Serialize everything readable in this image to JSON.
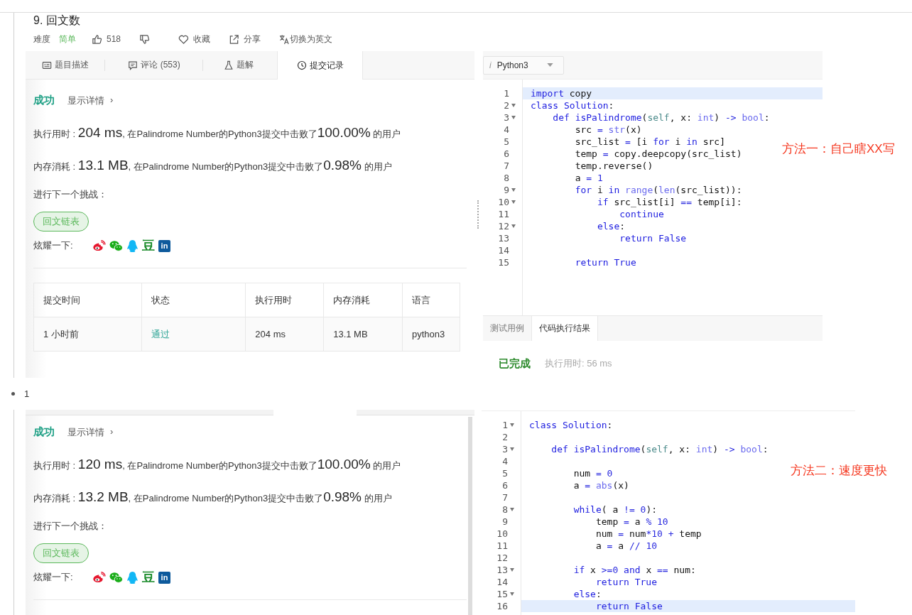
{
  "first_shot": {
    "problem": {
      "title": "9. 回文数",
      "difficulty_label": "难度",
      "difficulty": "简单",
      "likes": "518",
      "favorite": "收藏",
      "share": "分享",
      "switch_language": "切换为英文"
    },
    "tabs": [
      {
        "label": "题目描述",
        "selected": false
      },
      {
        "label": "评论 (553)",
        "selected": false
      },
      {
        "label": "题解",
        "selected": false
      },
      {
        "label": "提交记录",
        "selected": true
      }
    ],
    "result": {
      "status": "成功",
      "details": "显示详情",
      "chevron": "›",
      "stats": [
        {
          "label": "执行用时 : ",
          "value": "204 ms",
          "text": ", 在Palindrome Number的Python3提交中击败了",
          "percent": "100.00%",
          "suffix": " 的用户"
        },
        {
          "label": "内存消耗 : ",
          "value": "13.1 MB",
          "text": ", 在Palindrome Number的Python3提交中击败了",
          "percent": "0.98%",
          "suffix": " 的用户"
        }
      ],
      "next_label": "进行下一个挑战：",
      "next_tag": "回文链表",
      "share_label": "炫耀一下:",
      "share_icons": [
        {
          "kind": "swirl"
        },
        {
          "kind": "chat"
        },
        {
          "kind": "penguin"
        },
        {
          "kind": "glyph",
          "text": "豆"
        },
        {
          "kind": "badge",
          "text": "in"
        }
      ],
      "table": {
        "columns": [
          "提交时间",
          "状态",
          "执行用时",
          "内存消耗",
          "语言"
        ],
        "rows": [
          [
            {
              "text": "1 小时前",
              "kind": "plain"
            },
            {
              "text": "通过",
              "kind": "status"
            },
            {
              "text": "204 ms",
              "kind": "plain"
            },
            {
              "text": "13.1 MB",
              "kind": "plain"
            },
            {
              "text": "python3",
              "kind": "plain"
            }
          ]
        ]
      }
    },
    "editor": {
      "language_info": "i",
      "language": "Python3",
      "code": [
        {
          "number": "1",
          "text": "import copy",
          "fold": false,
          "highlighted": true
        },
        {
          "number": "2",
          "text": "class Solution:",
          "fold": true,
          "highlighted": false
        },
        {
          "number": "3",
          "text": "    def isPalindrome(self, x: int) -> bool:",
          "fold": true,
          "highlighted": false
        },
        {
          "number": "4",
          "text": "        src = str(x)",
          "fold": false,
          "highlighted": false
        },
        {
          "number": "5",
          "text": "        src_list = [i for i in src]",
          "fold": false,
          "highlighted": false
        },
        {
          "number": "6",
          "text": "        temp = copy.deepcopy(src_list)",
          "fold": false,
          "highlighted": false
        },
        {
          "number": "7",
          "text": "        temp.reverse()",
          "fold": false,
          "highlighted": false
        },
        {
          "number": "8",
          "text": "        a = 1",
          "fold": false,
          "highlighted": false
        },
        {
          "number": "9",
          "text": "        for i in range(len(src_list)):",
          "fold": true,
          "highlighted": false
        },
        {
          "number": "10",
          "text": "            if src_list[i] == temp[i]:",
          "fold": true,
          "highlighted": false
        },
        {
          "number": "11",
          "text": "                continue",
          "fold": false,
          "highlighted": false
        },
        {
          "number": "12",
          "text": "            else:",
          "fold": true,
          "highlighted": false
        },
        {
          "number": "13",
          "text": "                return False",
          "fold": false,
          "highlighted": false
        },
        {
          "number": "14",
          "fold": false,
          "highlighted": false
        },
        {
          "number": "15",
          "text": "        return True",
          "fold": false,
          "highlighted": false
        }
      ],
      "annotation": "方法一：自己瞎XX写",
      "console_tabs": [
        {
          "label": "测试用例",
          "selected": false
        },
        {
          "label": "代码执行结果",
          "selected": true
        }
      ],
      "console": {
        "status": "已完成",
        "runtime": "执行用时: 56 ms"
      }
    }
  },
  "bullet": "1",
  "second_shot": {
    "result": {
      "status": "成功",
      "details": "显示详情",
      "chevron": "›",
      "stats": [
        {
          "label": "执行用时 : ",
          "value": "120 ms",
          "text": ", 在Palindrome Number的Python3提交中击败了",
          "percent": "100.00%",
          "suffix": " 的用户"
        },
        {
          "label": "内存消耗 : ",
          "value": "13.2 MB",
          "text": ", 在Palindrome Number的Python3提交中击败了",
          "percent": "0.98%",
          "suffix": " 的用户"
        }
      ],
      "next_label": "进行下一个挑战：",
      "next_tag": "回文链表",
      "share_label": "炫耀一下:",
      "share_icons": [
        {
          "kind": "swirl"
        },
        {
          "kind": "chat"
        },
        {
          "kind": "penguin"
        },
        {
          "kind": "glyph",
          "text": "豆"
        },
        {
          "kind": "badge",
          "text": "in"
        }
      ]
    },
    "editor": {
      "code": [
        {
          "number": "1",
          "text": "class Solution:",
          "fold": true,
          "highlighted": false
        },
        {
          "number": "2",
          "fold": false,
          "highlighted": false
        },
        {
          "number": "3",
          "text": "    def isPalindrome(self, x: int) -> bool:",
          "fold": true,
          "highlighted": false
        },
        {
          "number": "4",
          "fold": false,
          "highlighted": false
        },
        {
          "number": "5",
          "text": "        num = 0",
          "fold": false,
          "highlighted": false
        },
        {
          "number": "6",
          "text": "        a = abs(x)",
          "fold": false,
          "highlighted": false
        },
        {
          "number": "7",
          "fold": false,
          "highlighted": false
        },
        {
          "number": "8",
          "text": "        while( a != 0):",
          "fold": true,
          "highlighted": false
        },
        {
          "number": "9",
          "text": "            temp = a % 10",
          "fold": false,
          "highlighted": false
        },
        {
          "number": "10",
          "text": "            num = num*10 + temp",
          "fold": false,
          "highlighted": false
        },
        {
          "number": "11",
          "text": "            a = a // 10",
          "fold": false,
          "highlighted": false
        },
        {
          "number": "12",
          "fold": false,
          "highlighted": false
        },
        {
          "number": "13",
          "text": "        if x >=0 and x == num:",
          "fold": true,
          "highlighted": false
        },
        {
          "number": "14",
          "text": "            return True",
          "fold": false,
          "highlighted": false
        },
        {
          "number": "15",
          "text": "        else:",
          "fold": true,
          "highlighted": false
        },
        {
          "number": "16",
          "text": "            return False",
          "fold": false,
          "highlighted": true
        }
      ],
      "annotation": "方法二：速度更快"
    }
  }
}
